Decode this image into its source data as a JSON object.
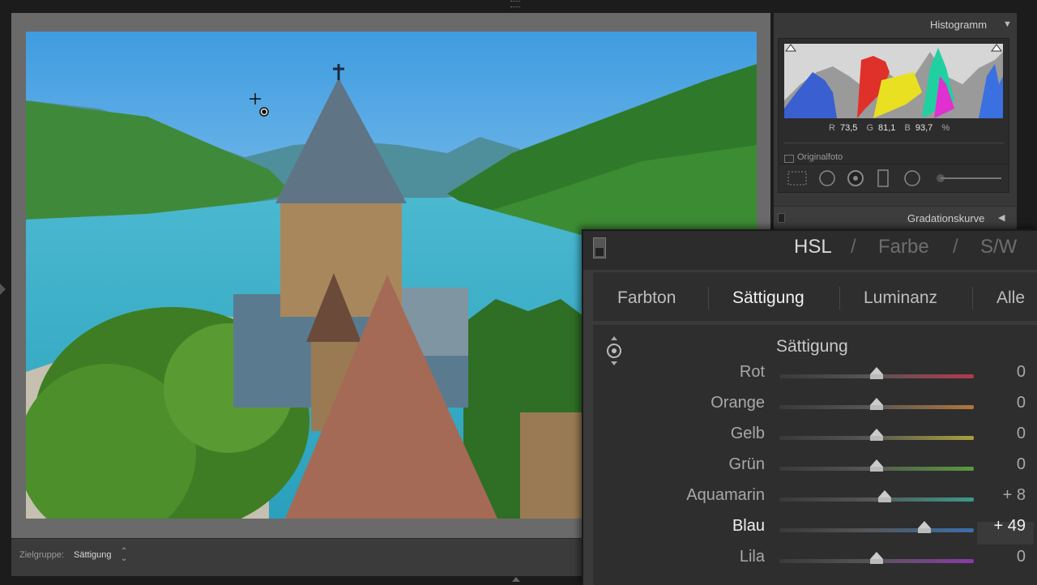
{
  "toolbar": {
    "target_label": "Zielgruppe:",
    "target_value": "Sättigung",
    "target_chevron": "⌃⌄"
  },
  "histogram": {
    "title": "Histogramm",
    "toggle": "▼",
    "r_label": "R",
    "r_value": "73,5",
    "g_label": "G",
    "g_value": "81,1",
    "b_label": "B",
    "b_value": "93,7",
    "unit": "%",
    "original_label": "Originalfoto"
  },
  "curve": {
    "title": "Gradationskurve",
    "toggle": "◀"
  },
  "hsl": {
    "titles": {
      "hsl": "HSL",
      "sep": "/",
      "farbe": "Farbe",
      "sw": "S/W"
    },
    "tabs": [
      "Farbton",
      "Sättigung",
      "Luminanz",
      "Alle"
    ],
    "active_tab": "Sättigung",
    "section_title": "Sättigung",
    "rows": [
      {
        "label": "Rot",
        "value": "0",
        "level": 0,
        "color": "#b23a4a"
      },
      {
        "label": "Orange",
        "value": "0",
        "level": 0,
        "color": "#b0773a"
      },
      {
        "label": "Gelb",
        "value": "0",
        "level": 0,
        "color": "#a9a23a"
      },
      {
        "label": "Grün",
        "value": "0",
        "level": 0,
        "color": "#5a9a3c"
      },
      {
        "label": "Aquamarin",
        "value": "+ 8",
        "level": 8,
        "color": "#3a9a8a"
      },
      {
        "label": "Blau",
        "value": "+ 49",
        "level": 49,
        "color": "#3a6fae"
      },
      {
        "label": "Lila",
        "value": "0",
        "level": 0,
        "color": "#8a3aa8"
      }
    ]
  }
}
